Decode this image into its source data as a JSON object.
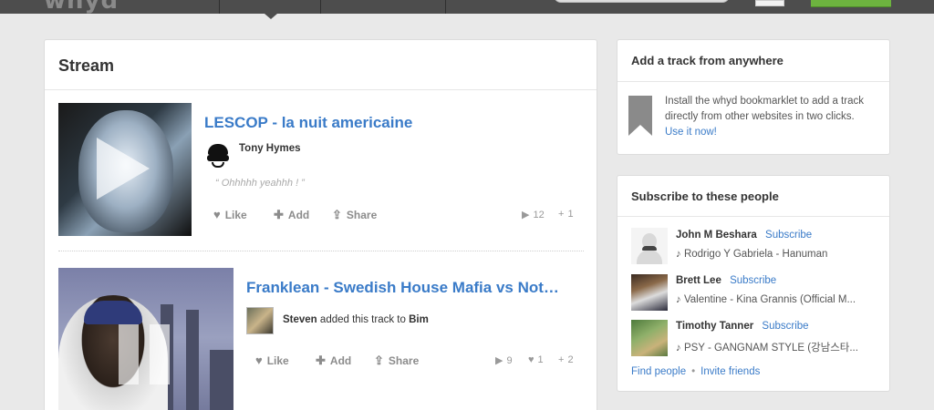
{
  "header": {
    "logo": "whyd"
  },
  "stream": {
    "title": "Stream",
    "posts": [
      {
        "title": "LESCOP - la nuit americaine",
        "user": "Tony Hymes",
        "comment": "“ Ohhhhh yeahhh ! ”",
        "actions": {
          "like": "Like",
          "add": "Add",
          "share": "Share"
        },
        "plays": "12",
        "adds": "1"
      },
      {
        "title": "Franklean - Swedish House Mafia vs Not…",
        "user": "Steven",
        "added_text": "added this track to",
        "playlist": "Bim",
        "actions": {
          "like": "Like",
          "add": "Add",
          "share": "Share"
        },
        "plays": "9",
        "likes": "1",
        "adds": "2"
      }
    ]
  },
  "bookmarklet": {
    "title": "Add a track from anywhere",
    "text": "Install the whyd bookmarklet to add a track directly from other websites in two clicks.",
    "link": "Use it now!"
  },
  "subscribe": {
    "title": "Subscribe to these people",
    "subscribe_label": "Subscribe",
    "people": [
      {
        "name": "John M Beshara",
        "track": "♪ Rodrigo Y Gabriela - Hanuman"
      },
      {
        "name": "Brett Lee",
        "track": "♪ Valentine - Kina Grannis (Official M..."
      },
      {
        "name": "Timothy Tanner",
        "track": "♪ PSY - GANGNAM STYLE (강남스타..."
      }
    ],
    "find_people": "Find people",
    "invite_friends": "Invite friends"
  },
  "colors": {
    "link": "#3a7bc8",
    "topbar": "#4d4d4d",
    "accent_green": "#6db33f"
  }
}
